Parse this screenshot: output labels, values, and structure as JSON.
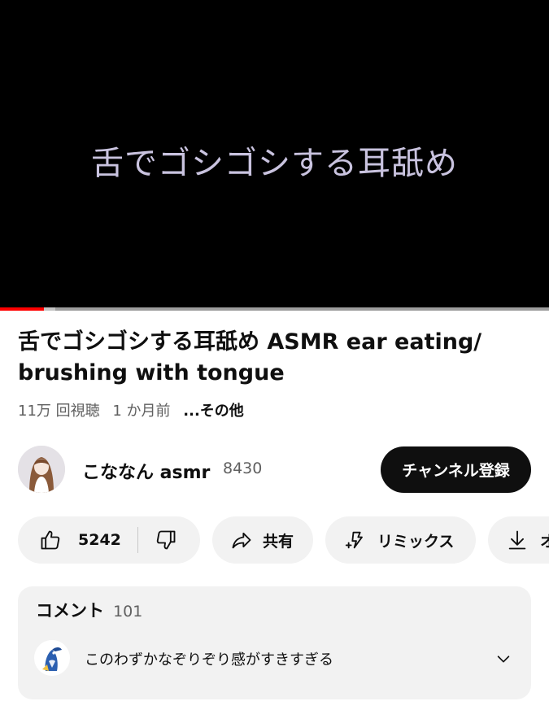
{
  "player": {
    "overlay_text": "舌でゴシゴシする耳舐め",
    "progress_fraction": 0.08,
    "buffer_fraction": 0.1
  },
  "video": {
    "title": "舌でゴシゴシする耳舐め ASMR ear eating/ brushing with tongue",
    "views": "11万 回視聴",
    "age": "1 か月前",
    "more_label": "...その他"
  },
  "channel": {
    "name": "こななん asmr",
    "subscribers": "8430",
    "subscribe_label": "チャンネル登録"
  },
  "actions": {
    "like_count": "5242",
    "share_label": "共有",
    "remix_label": "リミックス",
    "download_label": "オ"
  },
  "comments": {
    "label": "コメント",
    "count": "101",
    "top_comment": "このわずかなぞりぞり感がすきすぎる"
  },
  "icons": {
    "like": "thumb-up-icon",
    "dislike": "thumb-down-icon",
    "share": "share-arrow-icon",
    "remix": "remix-icon",
    "download": "download-icon",
    "expand": "chevron-down-icon"
  },
  "colors": {
    "progress": "#ff0000",
    "subscribe_bg": "#0f0f0f",
    "pill_bg": "#f2f2f2",
    "secondary_text": "#606060"
  }
}
